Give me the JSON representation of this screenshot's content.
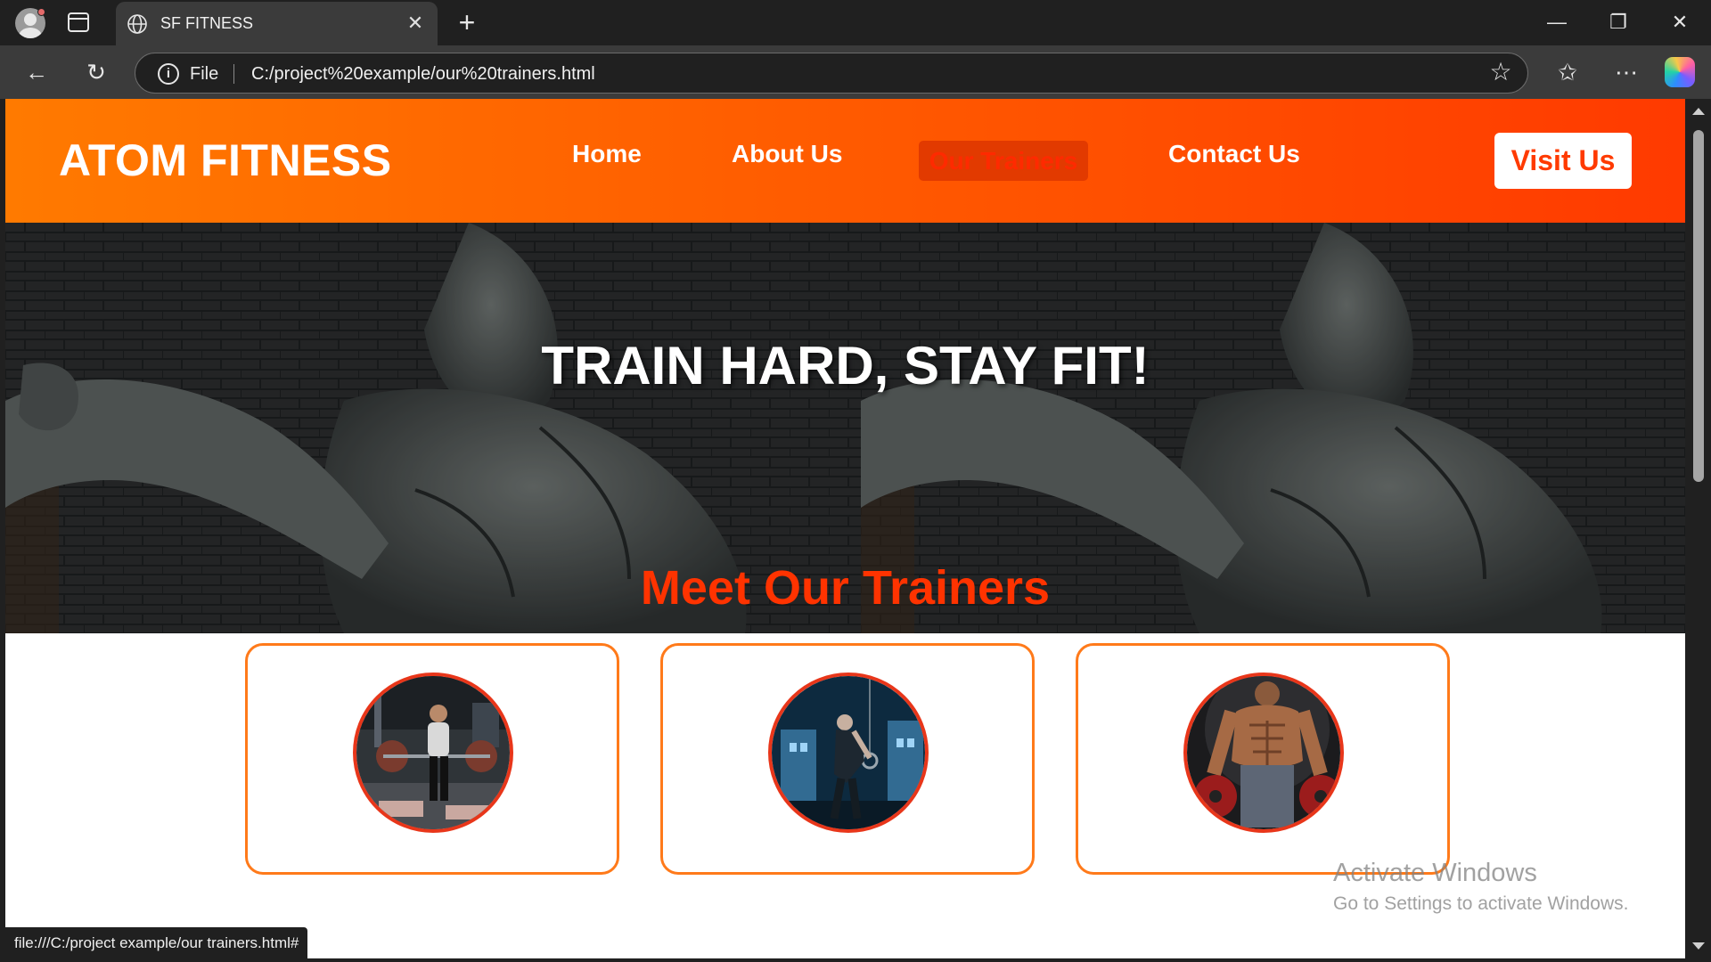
{
  "browser": {
    "tab_title": "SF FITNESS",
    "address_scheme": "File",
    "address_url": "C:/project%20example/our%20trainers.html",
    "status_url": "file:///C:/project example/our trainers.html#"
  },
  "site": {
    "logo": "ATOM FITNESS",
    "nav": [
      "Home",
      "About Us",
      "Our Trainers",
      "Contact Us"
    ],
    "active_nav": "Our Trainers",
    "visit_button": "Visit Us",
    "hero_title": "TRAIN HARD, STAY FIT!",
    "section_title": "Meet Our Trainers",
    "colors": {
      "accent": "#ff3a00",
      "header_start": "#ff7a00",
      "card_border": "#ff7a1a"
    }
  },
  "os_watermark": {
    "line1": "Activate Windows",
    "line2": "Go to Settings to activate Windows."
  }
}
